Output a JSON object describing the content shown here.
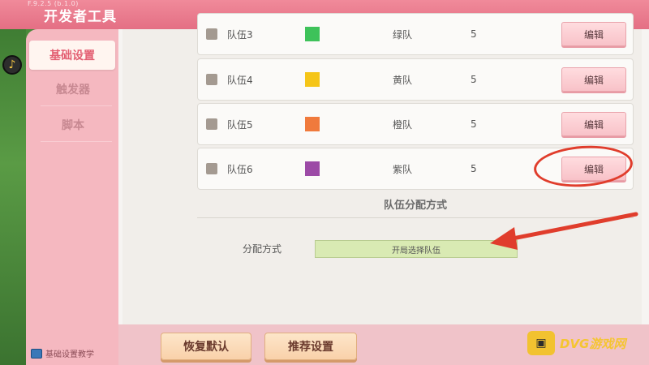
{
  "titlebar": {
    "version": "F.9.2.5 (b.1.0)",
    "title": "开发者工具"
  },
  "sidebar": {
    "items": [
      {
        "label": "基础设置"
      },
      {
        "label": "触发器"
      },
      {
        "label": "脚本"
      }
    ],
    "footer": "基础设置教学"
  },
  "teams": [
    {
      "name": "队伍3",
      "color": "#3ec25a",
      "label": "绿队",
      "count": "5",
      "edit": "编辑"
    },
    {
      "name": "队伍4",
      "color": "#f5c518",
      "label": "黄队",
      "count": "5",
      "edit": "编辑"
    },
    {
      "name": "队伍5",
      "color": "#f07a3c",
      "label": "橙队",
      "count": "5",
      "edit": "编辑"
    },
    {
      "name": "队伍6",
      "color": "#9c4aa6",
      "label": "紫队",
      "count": "5",
      "edit": "编辑"
    }
  ],
  "assignment": {
    "section_title": "队伍分配方式",
    "label": "分配方式",
    "value": "开局选择队伍"
  },
  "bottom": {
    "reset": "恢复默认",
    "recommend": "推荐设置"
  },
  "watermark": {
    "text": "DVG游戏网"
  },
  "colors": {
    "annotation": "#e03d2c",
    "accent": "#e35f72"
  }
}
